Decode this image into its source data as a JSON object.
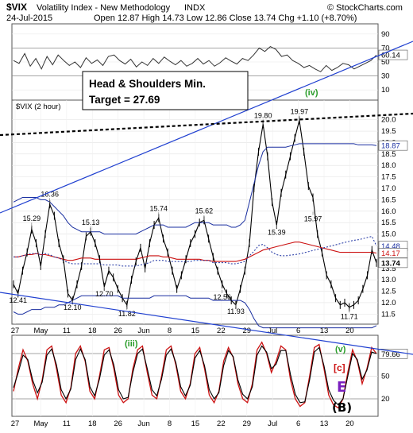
{
  "header": {
    "ticker": "$VIX",
    "name": "Volatility Index - New Methodology",
    "exchange": "INDX",
    "credit": "© StockCharts.com",
    "date": "24-Jul-2015",
    "ohlc": "Open 12.87 High 14.73 Low 12.86 Close 13.74 Chg +1.10 (+8.70%)"
  },
  "annotation": {
    "line1": "Head & Shoulders Min.",
    "line2": "Target = 27.69"
  },
  "wave_labels": {
    "iv": "(iv)",
    "iii": "(iii)",
    "v": "(v)",
    "c": "[c]",
    "E": "E",
    "B": "(B)"
  },
  "colors": {
    "price": "#000000",
    "sma": "#cc1111",
    "bollinger": "#1a2fa0",
    "trendline": "#2040d0",
    "neckline": "#000000",
    "wave_green": "#2a9d2a",
    "wave_red": "#cc1111",
    "wave_purple": "#7a1fbf",
    "stoch_k": "#cc1111",
    "stoch_d": "#000000",
    "rsi": "#333333"
  },
  "chart_data": [
    {
      "type": "line",
      "panel": "rsi",
      "yticks": [
        10,
        30,
        50,
        70,
        90
      ],
      "ylim": [
        0,
        100
      ],
      "readout": "60.14",
      "values": [
        52,
        48,
        62,
        44,
        55,
        40,
        58,
        46,
        60,
        52,
        45,
        50,
        42,
        56,
        48,
        53,
        45,
        58,
        60,
        52,
        47,
        54,
        43,
        50,
        45,
        55,
        48,
        57,
        51,
        46,
        52,
        44,
        48,
        55,
        47,
        52,
        44,
        49,
        56,
        51,
        47,
        55,
        52,
        60,
        70,
        65,
        72,
        68,
        58,
        60,
        52,
        48,
        42,
        45,
        40,
        36,
        45,
        38,
        42,
        48,
        46,
        40,
        44,
        48,
        52,
        60
      ]
    },
    {
      "type": "line",
      "panel": "price",
      "title": "$VIX (2 hour)",
      "ylim": [
        11.2,
        20.3
      ],
      "yticks": [
        11.5,
        12.0,
        12.5,
        13.0,
        13.5,
        14.0,
        14.5,
        15.0,
        15.5,
        16.0,
        16.5,
        17.0,
        17.5,
        18.0,
        18.5,
        19.0,
        19.5,
        20.0
      ],
      "xticks": [
        "27",
        "May",
        "11",
        "18",
        "26",
        "Jun",
        "8",
        "15",
        "22",
        "29",
        "Jul",
        "6",
        "13",
        "20"
      ],
      "readouts": {
        "upper_band": "18.87",
        "band_14_48": "14.48",
        "band_14_17": "14.17",
        "last": "13.74"
      },
      "price_labels": [
        {
          "text": "12.41",
          "value": 12.41
        },
        {
          "text": "15.29",
          "value": 15.29
        },
        {
          "text": "16.36",
          "value": 16.36
        },
        {
          "text": "12.10",
          "value": 12.1
        },
        {
          "text": "15.13",
          "value": 15.13
        },
        {
          "text": "12.70",
          "value": 12.7
        },
        {
          "text": "11.82",
          "value": 11.82
        },
        {
          "text": "15.74",
          "value": 15.74
        },
        {
          "text": "15.62",
          "value": 15.62
        },
        {
          "text": "12.56",
          "value": 12.56
        },
        {
          "text": "11.93",
          "value": 11.93
        },
        {
          "text": "19.80",
          "value": 19.8
        },
        {
          "text": "15.39",
          "value": 15.39
        },
        {
          "text": "19.97",
          "value": 19.97
        },
        {
          "text": "15.97",
          "value": 15.97
        },
        {
          "text": "11.71",
          "value": 11.71
        }
      ],
      "series": [
        {
          "name": "price",
          "values": [
            12.8,
            12.4,
            13.4,
            14.2,
            15.2,
            14.6,
            13.6,
            15.0,
            16.3,
            15.8,
            14.6,
            13.9,
            12.4,
            12.1,
            12.8,
            13.6,
            14.9,
            15.1,
            14.6,
            13.9,
            12.7,
            13.4,
            13.1,
            12.6,
            12.2,
            11.9,
            13.0,
            13.8,
            14.4,
            13.5,
            14.6,
            15.4,
            15.7,
            14.8,
            14.2,
            13.4,
            12.6,
            13.2,
            13.9,
            14.6,
            15.0,
            15.5,
            15.6,
            14.8,
            14.0,
            13.4,
            12.8,
            12.4,
            12.1,
            11.9,
            12.6,
            13.4,
            14.6,
            17.0,
            18.6,
            19.8,
            18.4,
            16.4,
            15.4,
            16.8,
            17.6,
            18.4,
            19.2,
            19.97,
            18.6,
            17.1,
            16.6,
            15.0,
            14.2,
            13.2,
            12.8,
            12.2,
            11.9,
            12.0,
            11.8,
            11.9,
            12.1,
            12.6,
            13.2,
            14.3,
            13.74
          ]
        },
        {
          "name": "sma",
          "values": [
            14.0,
            14.0,
            14.05,
            14.1,
            14.1,
            14.15,
            14.1,
            14.1,
            14.05,
            14.0,
            13.95,
            13.9,
            13.85,
            13.85,
            13.9,
            13.95,
            13.95,
            13.95,
            13.9,
            13.9,
            13.9,
            13.9,
            13.9,
            13.9,
            13.9,
            13.9,
            13.9,
            13.9,
            13.95,
            14.0,
            14.05,
            14.05,
            14.05,
            14.0,
            14.0,
            13.95,
            13.9,
            13.9,
            13.9,
            13.9,
            13.9,
            13.9,
            13.85,
            13.85,
            13.8,
            13.8,
            13.8,
            13.8,
            13.8,
            13.8,
            13.85,
            13.9,
            14.0,
            14.1,
            14.2,
            14.3,
            14.35,
            14.4,
            14.45,
            14.5,
            14.55,
            14.6,
            14.65,
            14.65,
            14.6,
            14.55,
            14.5,
            14.45,
            14.4,
            14.35,
            14.3,
            14.25,
            14.2,
            14.2,
            14.2,
            14.2,
            14.2,
            14.2,
            14.2,
            14.2,
            14.17
          ]
        },
        {
          "name": "upper_band",
          "values": [
            16.4,
            16.5,
            16.6,
            16.6,
            16.6,
            16.6,
            16.5,
            16.5,
            16.4,
            16.2,
            16.0,
            15.8,
            15.5,
            15.3,
            15.2,
            15.1,
            15.1,
            15.1,
            15.1,
            15.1,
            15.0,
            15.0,
            15.0,
            15.0,
            15.0,
            15.0,
            15.0,
            15.0,
            15.1,
            15.2,
            15.3,
            15.4,
            15.4,
            15.4,
            15.3,
            15.3,
            15.3,
            15.3,
            15.3,
            15.4,
            15.5,
            15.5,
            15.5,
            15.5,
            15.4,
            15.4,
            15.4,
            15.4,
            15.3,
            15.3,
            15.4,
            15.6,
            16.4,
            17.2,
            18.0,
            18.6,
            18.8,
            18.8,
            18.8,
            18.8,
            18.8,
            18.85,
            18.9,
            18.95,
            18.95,
            18.95,
            18.95,
            18.95,
            18.95,
            18.95,
            18.95,
            18.95,
            18.95,
            18.95,
            18.95,
            18.95,
            18.9,
            18.9,
            18.9,
            18.9,
            18.87
          ]
        },
        {
          "name": "lower_band",
          "values": [
            11.6,
            11.5,
            11.5,
            11.6,
            11.7,
            11.7,
            11.7,
            11.8,
            11.8,
            11.8,
            11.9,
            11.9,
            12.0,
            12.1,
            12.2,
            12.3,
            12.3,
            12.3,
            12.3,
            12.3,
            12.3,
            12.3,
            12.3,
            12.3,
            12.2,
            12.2,
            12.2,
            12.2,
            12.2,
            12.2,
            12.2,
            12.3,
            12.3,
            12.3,
            12.3,
            12.3,
            12.3,
            12.3,
            12.3,
            12.2,
            12.2,
            12.2,
            12.2,
            12.2,
            12.1,
            12.1,
            12.1,
            12.1,
            12.1,
            12.1,
            12.1,
            12.0,
            11.7,
            11.3,
            11.0,
            10.5,
            10.0,
            9.6,
            9.4,
            9.3,
            9.3,
            9.3,
            9.3,
            9.3,
            9.4,
            9.5,
            9.6,
            9.7,
            9.8,
            9.9,
            10.0,
            10.1,
            10.2,
            10.3,
            10.4,
            10.5,
            10.6,
            10.7,
            10.8,
            10.9,
            11.0
          ]
        },
        {
          "name": "mid_band",
          "values": [
            14.0,
            14.0,
            14.05,
            14.1,
            14.15,
            14.15,
            14.1,
            14.15,
            14.1,
            14.0,
            13.95,
            13.85,
            13.75,
            13.7,
            13.7,
            13.7,
            13.7,
            13.7,
            13.7,
            13.7,
            13.65,
            13.65,
            13.65,
            13.65,
            13.6,
            13.6,
            13.6,
            13.6,
            13.65,
            13.7,
            13.75,
            13.85,
            13.85,
            13.85,
            13.8,
            13.8,
            13.8,
            13.8,
            13.8,
            13.8,
            13.85,
            13.85,
            13.85,
            13.85,
            13.75,
            13.75,
            13.75,
            13.75,
            13.7,
            13.7,
            13.75,
            13.8,
            14.05,
            14.25,
            14.5,
            14.55,
            14.4,
            14.2,
            14.1,
            14.05,
            14.05,
            14.08,
            14.1,
            14.13,
            14.18,
            14.23,
            14.28,
            14.33,
            14.38,
            14.43,
            14.48,
            14.53,
            14.58,
            14.63,
            14.68,
            14.73,
            14.75,
            14.8,
            14.85,
            14.9,
            14.48
          ]
        }
      ]
    },
    {
      "type": "line",
      "panel": "stochastic",
      "ylim": [
        0,
        100
      ],
      "yticks": [
        20,
        50,
        80
      ],
      "readout": "79.66",
      "series": [
        {
          "name": "%K",
          "values": [
            30,
            60,
            85,
            70,
            40,
            20,
            45,
            85,
            90,
            60,
            25,
            15,
            35,
            80,
            90,
            70,
            30,
            20,
            50,
            85,
            88,
            60,
            25,
            15,
            20,
            60,
            85,
            90,
            55,
            25,
            20,
            50,
            85,
            90,
            65,
            30,
            20,
            40,
            80,
            88,
            60,
            25,
            15,
            30,
            70,
            88,
            75,
            40,
            20,
            15,
            40,
            85,
            95,
            80,
            55,
            70,
            90,
            85,
            45,
            20,
            10,
            15,
            50,
            88,
            92,
            60,
            25,
            12,
            8,
            20,
            55,
            85,
            70,
            40,
            60,
            88,
            80
          ]
        },
        {
          "name": "%D",
          "values": [
            35,
            55,
            78,
            72,
            45,
            28,
            42,
            78,
            86,
            65,
            32,
            20,
            33,
            72,
            86,
            72,
            36,
            24,
            46,
            78,
            85,
            65,
            32,
            20,
            22,
            55,
            80,
            86,
            60,
            32,
            24,
            46,
            78,
            86,
            68,
            36,
            24,
            38,
            74,
            84,
            64,
            32,
            20,
            28,
            64,
            84,
            76,
            45,
            26,
            20,
            36,
            78,
            90,
            82,
            60,
            66,
            84,
            84,
            52,
            26,
            15,
            16,
            45,
            82,
            88,
            64,
            32,
            18,
            12,
            20,
            50,
            80,
            72,
            46,
            58,
            82,
            80
          ]
        }
      ]
    }
  ]
}
